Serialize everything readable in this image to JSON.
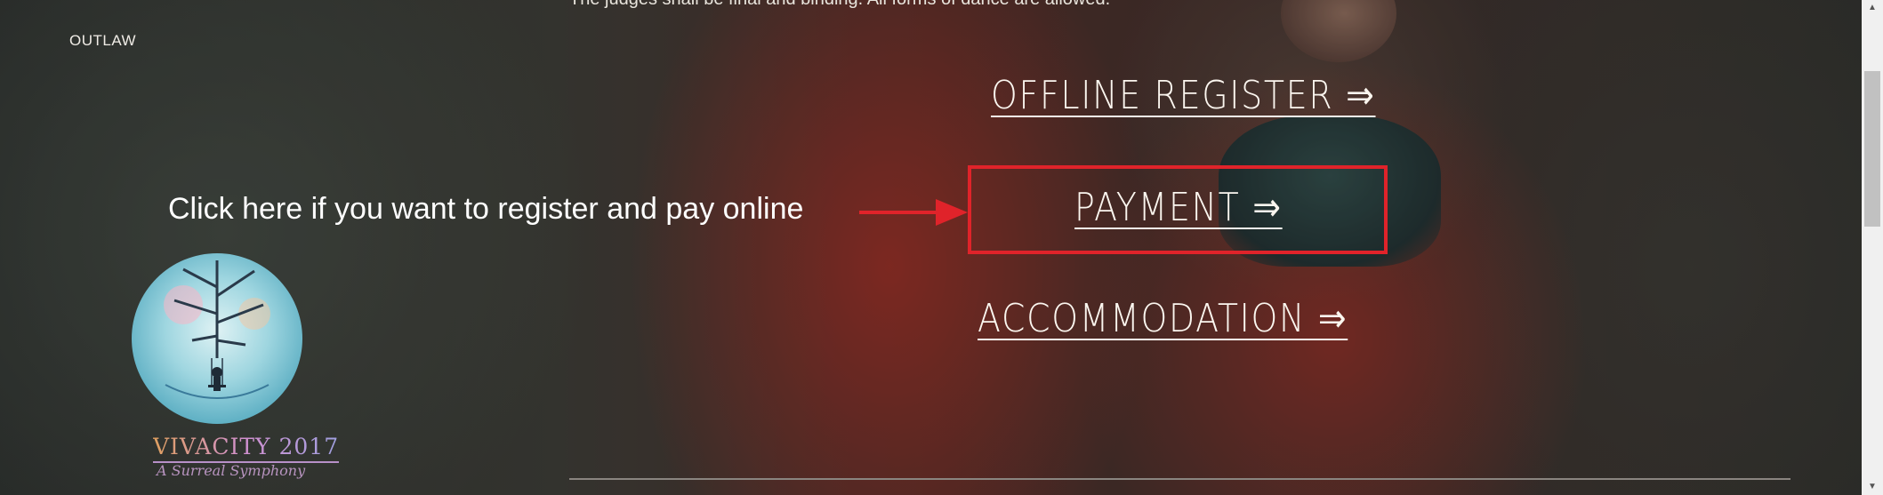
{
  "page": {
    "top_partial_text": "The judges shall be final and binding. All forms of dance are allowed.",
    "brand_label": "OUTLAW"
  },
  "nav": {
    "offline_register": "OFFLINE REGISTER ⇒",
    "payment": "PAYMENT ⇒",
    "accommodation": "ACCOMMODATION ⇒"
  },
  "annotation": {
    "text": "Click here if you want to register and pay online",
    "color": "#e0232a"
  },
  "logo": {
    "title": "VIVACITY 2017",
    "subtitle": "A Surreal Symphony"
  },
  "scrollbar": {
    "up_icon": "▲",
    "down_icon": "▼"
  }
}
